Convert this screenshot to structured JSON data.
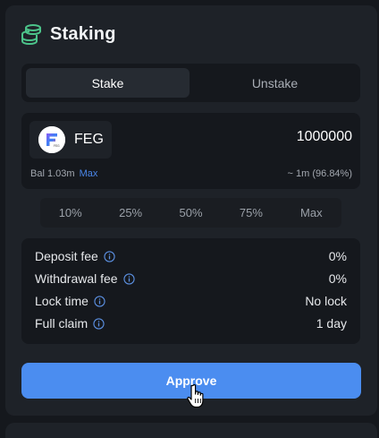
{
  "header": {
    "title": "Staking",
    "icon": "coin-stack-icon",
    "accent": "#4cc38a"
  },
  "tabs": [
    {
      "label": "Stake",
      "active": true
    },
    {
      "label": "Unstake",
      "active": false
    }
  ],
  "token": {
    "symbol": "FEG",
    "logo_text": "FEG",
    "amount": "1000000",
    "balance": "Bal 1.03m",
    "max_label": "Max",
    "usd_estimate": "~ 1m (96.84%)"
  },
  "percent_options": [
    "10%",
    "25%",
    "50%",
    "75%",
    "Max"
  ],
  "fees": [
    {
      "label": "Deposit fee",
      "value": "0%"
    },
    {
      "label": "Withdrawal fee",
      "value": "0%"
    },
    {
      "label": "Lock time",
      "value": "No lock"
    },
    {
      "label": "Full claim",
      "value": "1 day"
    }
  ],
  "approve_label": "Approve",
  "colors": {
    "primary": "#4b8df0",
    "link": "#4a86e8",
    "info": "#5b8fe0"
  }
}
